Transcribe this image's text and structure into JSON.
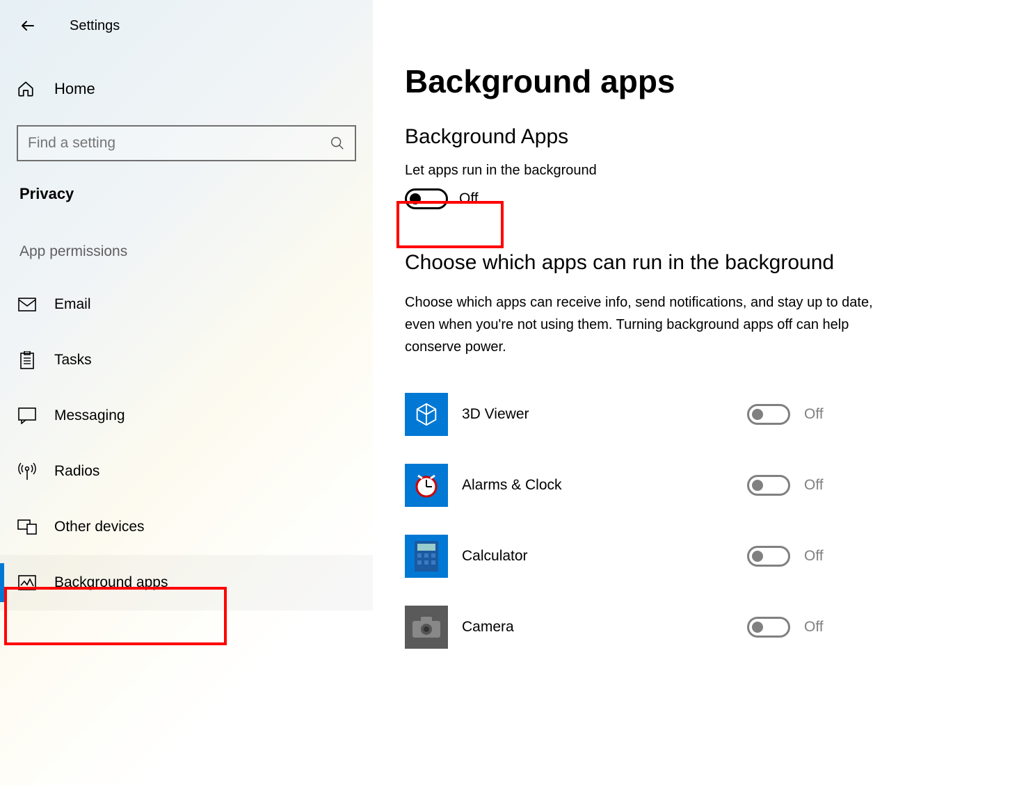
{
  "window": {
    "title": "Settings"
  },
  "sidebar": {
    "home": "Home",
    "search_placeholder": "Find a setting",
    "category": "Privacy",
    "section": "App permissions",
    "items": [
      {
        "label": "Email"
      },
      {
        "label": "Tasks"
      },
      {
        "label": "Messaging"
      },
      {
        "label": "Radios"
      },
      {
        "label": "Other devices"
      },
      {
        "label": "Background apps"
      }
    ]
  },
  "main": {
    "title": "Background apps",
    "subtitle": "Background Apps",
    "master_label": "Let apps run in the background",
    "master_state": "Off",
    "choose_heading": "Choose which apps can run in the background",
    "choose_body": "Choose which apps can receive info, send notifications, and stay up to date, even when you're not using them. Turning background apps off can help conserve power.",
    "apps": [
      {
        "name": "3D Viewer",
        "state": "Off"
      },
      {
        "name": "Alarms & Clock",
        "state": "Off"
      },
      {
        "name": "Calculator",
        "state": "Off"
      },
      {
        "name": "Camera",
        "state": "Off"
      }
    ]
  }
}
